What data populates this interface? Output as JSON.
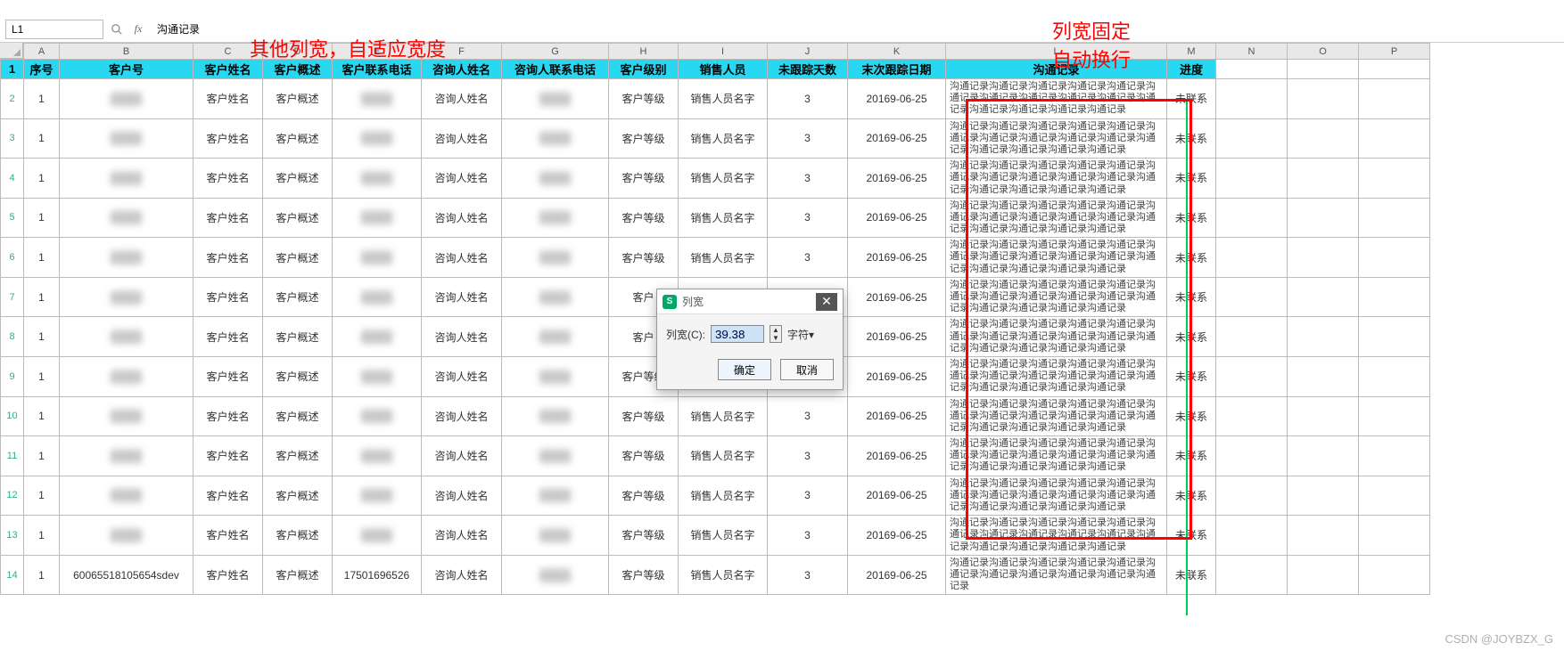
{
  "annotations": {
    "left": "其他列宽，自适应宽度",
    "right_line1": "列宽固定",
    "right_line2": "自动换行"
  },
  "formula_bar": {
    "cell_ref": "L1",
    "fx": "fx",
    "content": "沟通记录"
  },
  "column_letters": [
    "A",
    "B",
    "C",
    "D",
    "E",
    "F",
    "G",
    "H",
    "I",
    "J",
    "K",
    "L",
    "M",
    "N",
    "O",
    "P"
  ],
  "headers": {
    "A": "序号",
    "B": "客户号",
    "C": "客户姓名",
    "D": "客户概述",
    "E": "客户联系电话",
    "F": "咨询人姓名",
    "G": "咨询人联系电话",
    "H": "客户级别",
    "I": "销售人员",
    "J": "未跟踪天数",
    "K": "末次跟踪日期",
    "L": "沟通记录",
    "M": "进度"
  },
  "row_defaults": {
    "seq": "1",
    "cust_name": "客户姓名",
    "cust_desc": "客户概述",
    "consult_name": "咨询人姓名",
    "level": "客户等级",
    "sales": "销售人员名字",
    "days": "3",
    "date": "20169-06-25",
    "status": "未联系"
  },
  "rows": [
    {
      "L": "沟通记录沟通\n记录沟通记录沟通记录沟通记录沟通记录沟通记录\n沟通记录沟通记录\n沟通记录沟通记录沟通记录沟通记录沟通记录沟通\n记录"
    },
    {
      "L": "沟通记录沟通记录沟通记录沟通记录沟通记录沟通\n记录沟通记录沟通记录沟通记录沟通记录沟通记录\n沟通记录沟通记录沟通记录沟通记录"
    },
    {
      "L": "沟通记录沟通记录沟通记录沟通记录沟通记录沟通\n记录沟通记录沟通记录沟通记录沟通记录沟通记录\n沟通记录沟通记录沟通记录沟通记录"
    },
    {
      "L": "沟通记录沟通记录沟通记录沟通记录沟通记录沟通\n记录沟通记录沟通记录沟通记录沟通记录沟通记录\n沟通记录沟通记录沟通记录沟通记录"
    },
    {
      "L": "沟通记录沟通记录沟通记录沟通记录沟通记录沟通\n记录沟通记录沟通记录沟通记录沟通记录沟通记录\n沟通记录沟通记录沟通记录沟通记录",
      "level_override": "客户等级"
    },
    {
      "L": "沟通记录沟通记录沟通记录沟通记录沟通记录沟通\n记录沟通记录沟通记录沟通记录沟通记录沟通记录\n沟通记录沟通记录沟通记录沟通记录",
      "level_override": "客户"
    },
    {
      "L": "沟通记录沟通记录沟通记录沟通记录沟通记录沟通\n记录沟通记录沟通记录沟通记录沟通记录沟通记录\n沟通记录沟通记录沟通记录沟通记录",
      "level_override": "客户"
    },
    {
      "L": "沟通记录沟通记录沟通记录沟通记录沟通记录沟通\n记录沟通记录沟通记录沟通记录沟通记录沟通记录\n沟通记录沟通记录沟通记录沟通记录"
    },
    {
      "L": "沟通记录沟通记录沟通记录沟通记录沟通记录沟通\n记录沟通记录沟通记录沟通记录沟通记录沟通记录\n沟通记录沟通记录沟通记录沟通记录"
    },
    {
      "L": "沟通记录沟通记录沟通记录沟通记录沟通记录沟通\n记录沟通记录沟通记录沟通记录沟通记录沟通记录\n沟通记录沟通记录沟通记录沟通记录"
    },
    {
      "L": "沟通记录沟通记录沟通记录沟通记录沟通记录沟通\n记录沟通记录沟通记录沟通记录沟通记录沟通记录\n沟通记录沟通记录沟通记录沟通记录"
    },
    {
      "L": "沟通记录沟通记录沟通记录沟通记录沟通记录沟通\n记录沟通记录沟通记录沟通记录沟通记录沟通记录\n沟通记录沟通记录沟通记录沟通记录"
    },
    {
      "L": "沟通记录沟通记录沟通记录沟通记录沟通记录沟通\n记录沟通记录沟通记录沟通记录沟通记录沟通记录",
      "B": "60065518105654sdev",
      "E": "17501696526"
    }
  ],
  "dialog": {
    "title": "列宽",
    "label": "列宽(C):",
    "value": "39.38",
    "unit": "字符",
    "ok": "确定",
    "cancel": "取消"
  },
  "watermark": "CSDN @JOYBZX_G"
}
